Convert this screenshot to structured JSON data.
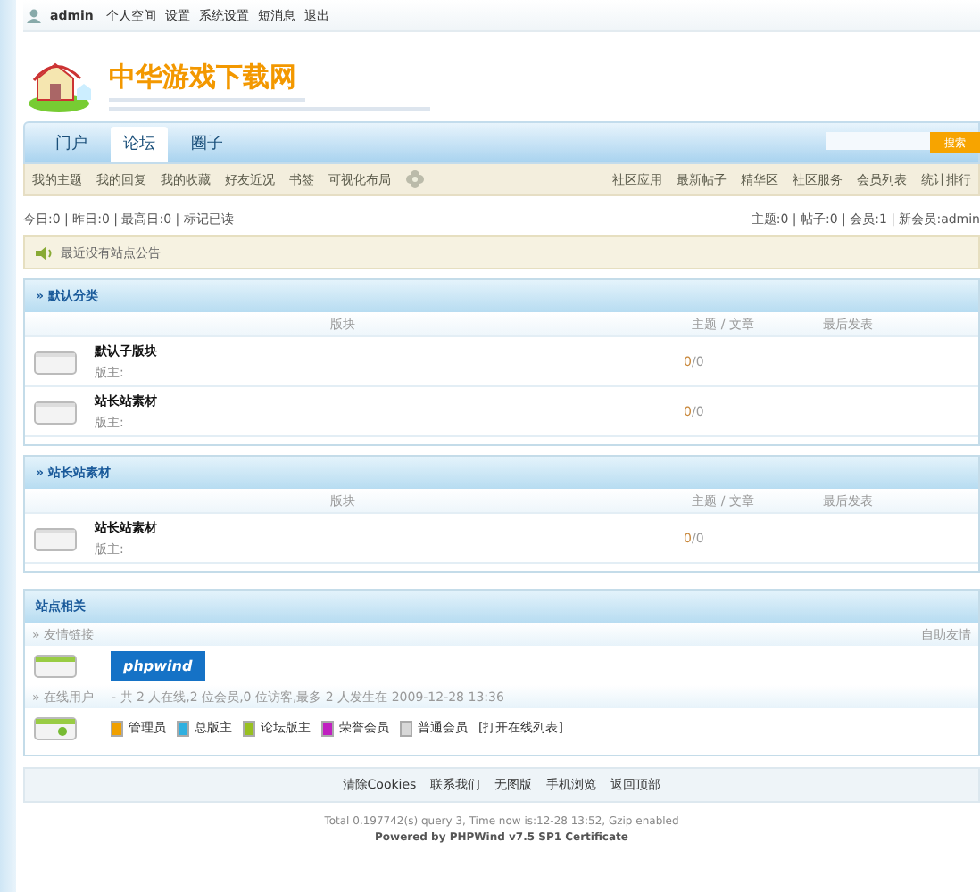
{
  "top_bar": {
    "user": "admin",
    "links": [
      "个人空间",
      "设置",
      "系统设置",
      "短消息",
      "退出"
    ]
  },
  "logo": {
    "title": "中华游戏下载网"
  },
  "nav": {
    "tabs": [
      {
        "label": "门户",
        "selected": false
      },
      {
        "label": "论坛",
        "selected": true
      },
      {
        "label": "圈子",
        "selected": false
      }
    ],
    "search_button": "搜索"
  },
  "sub_nav": {
    "left": [
      "我的主题",
      "我的回复",
      "我的收藏",
      "好友近况",
      "书签",
      "可视化布局"
    ],
    "right": [
      "社区应用",
      "最新帖子",
      "精华区",
      "社区服务",
      "会员列表",
      "统计排行"
    ]
  },
  "stats": {
    "left": "今日:0 | 昨日:0 | 最高日:0 | 标记已读",
    "right": "主题:0 | 帖子:0 | 会员:1 | 新会员:admin"
  },
  "notice": "最近没有站点公告",
  "categories": [
    {
      "title": "» 默认分类",
      "columns": [
        "版块",
        "主题 / 文章",
        "最后发表"
      ],
      "forums": [
        {
          "name": "默认子版块",
          "moderator": "版主:",
          "topics": "0",
          "posts": "/0"
        },
        {
          "name": "站长站素材",
          "moderator": "版主:",
          "topics": "0",
          "posts": "/0"
        }
      ]
    },
    {
      "title": "» 站长站素材",
      "columns": [
        "版块",
        "主题 / 文章",
        "最后发表"
      ],
      "forums": [
        {
          "name": "站长站素材",
          "moderator": "版主:",
          "topics": "0",
          "posts": "/0"
        }
      ]
    }
  ],
  "site": {
    "title": "站点相关",
    "links_label": "» 友情链接",
    "links_right": "自助友情",
    "partner_logo": "phpwind",
    "online_label": "» 在线用户",
    "online_text": "- 共 2 人在线,2 位会员,0 位访客,最多 2 人发生在 2009-12-28 13:36",
    "legend": [
      {
        "label": "管理员",
        "color": "#f0a000"
      },
      {
        "label": "总版主",
        "color": "#30b0e0"
      },
      {
        "label": "论坛版主",
        "color": "#98c020"
      },
      {
        "label": "荣誉会员",
        "color": "#c020c0"
      },
      {
        "label": "普通会员",
        "color": "#d8d8d8"
      }
    ],
    "open_list": "[打开在线列表]"
  },
  "footer": {
    "links": [
      "清除Cookies",
      "联系我们",
      "无图版",
      "手机浏览",
      "返回顶部"
    ],
    "total": "Total 0.197742(s) query 3, Time now is:12-28 13:52, Gzip enabled",
    "powered": "Powered by PHPWind v7.5 SP1 Certificate"
  }
}
